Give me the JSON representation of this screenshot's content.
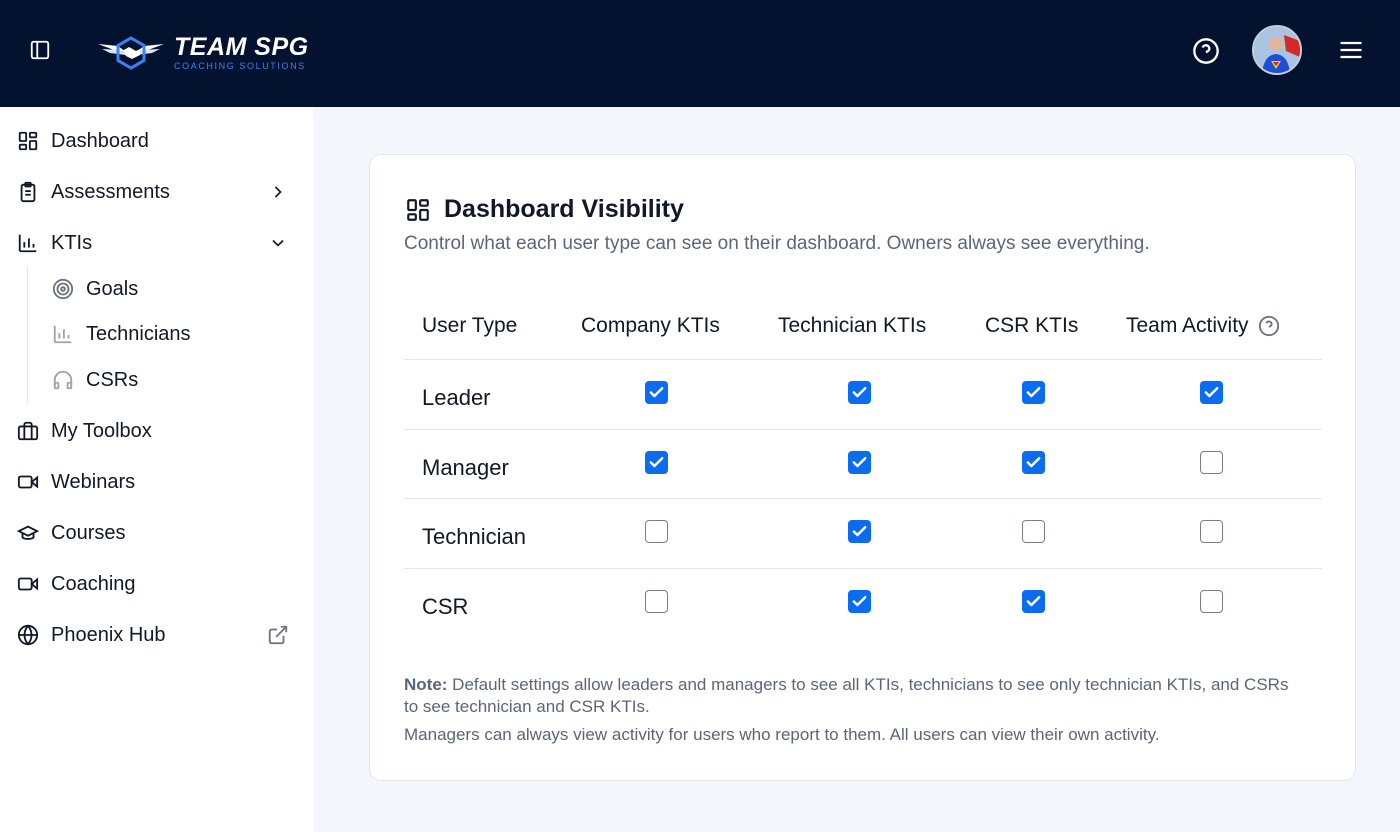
{
  "brand": {
    "title": "TEAM SPG",
    "subtitle": "COACHING SOLUTIONS"
  },
  "sidebar": {
    "items": [
      {
        "label": "Dashboard",
        "icon": "dashboard-icon"
      },
      {
        "label": "Assessments",
        "icon": "clipboard-icon"
      },
      {
        "label": "KTIs",
        "icon": "bar-chart-icon",
        "expanded": true,
        "children": [
          {
            "label": "Goals",
            "icon": "target-icon"
          },
          {
            "label": "Technicians",
            "icon": "bar-chart-icon"
          },
          {
            "label": "CSRs",
            "icon": "headphones-icon"
          }
        ]
      },
      {
        "label": "My Toolbox",
        "icon": "briefcase-icon"
      },
      {
        "label": "Webinars",
        "icon": "video-icon"
      },
      {
        "label": "Courses",
        "icon": "graduation-cap-icon"
      },
      {
        "label": "Coaching",
        "icon": "video-icon"
      },
      {
        "label": "Phoenix Hub",
        "icon": "globe-icon",
        "external": true
      }
    ]
  },
  "card": {
    "title": "Dashboard Visibility",
    "description": "Control what each user type can see on their dashboard. Owners always see everything.",
    "columns": [
      "User Type",
      "Company KTIs",
      "Technician KTIs",
      "CSR KTIs",
      "Team Activity"
    ],
    "rows": [
      {
        "label": "Leader",
        "values": [
          true,
          true,
          true,
          true
        ]
      },
      {
        "label": "Manager",
        "values": [
          true,
          true,
          true,
          false
        ]
      },
      {
        "label": "Technician",
        "values": [
          false,
          true,
          false,
          false
        ]
      },
      {
        "label": "CSR",
        "values": [
          false,
          true,
          true,
          false
        ]
      }
    ],
    "note_label": "Note:",
    "note_text": " Default settings allow leaders and managers to see all KTIs, technicians to see only technician KTIs, and CSRs to see technician and CSR KTIs.",
    "note_secondary": "Managers can always view activity for users who report to them. All users can view their own activity."
  },
  "colors": {
    "header_bg": "#03122e",
    "accent": "#0b6cf0",
    "page_bg": "#f3f6fa"
  }
}
